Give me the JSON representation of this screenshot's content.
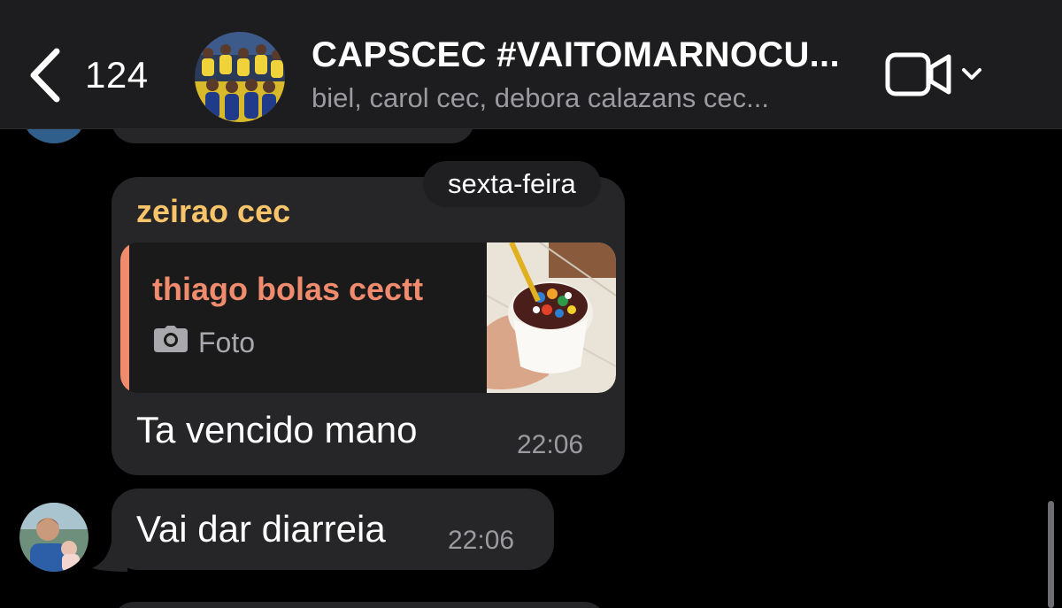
{
  "header": {
    "back_count": "124",
    "title": "CAPSCEC #VAITOMARNOCU...",
    "subtitle": "biel, carol cec, debora calazans cec..."
  },
  "date_separator": "sexta-feira",
  "messages": [
    {
      "sender": "zeirao cec",
      "reply": {
        "author": "thiago bolas cectt",
        "type": "Foto"
      },
      "text": "Ta vencido mano",
      "time": "22:06"
    },
    {
      "text": "Vai dar diarreia",
      "time": "22:06"
    }
  ],
  "colors": {
    "background": "#000000",
    "header": "#1d1d1f",
    "bubble": "#262628",
    "sender_name": "#f7c469",
    "reply_accent": "#f08b6d",
    "secondary_text": "#9b9b9f"
  },
  "icons": [
    "chevron-left-icon",
    "video-camera-icon",
    "chevron-down-icon",
    "camera-icon"
  ]
}
